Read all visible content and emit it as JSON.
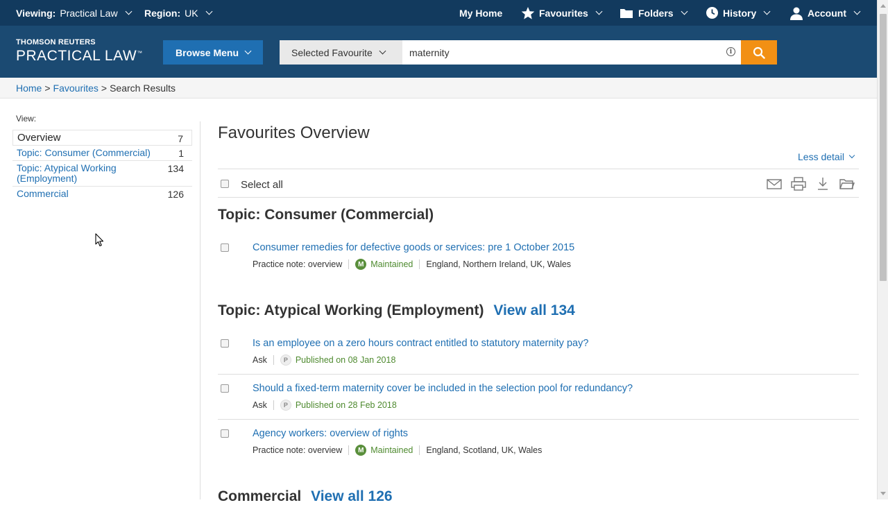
{
  "topbar": {
    "viewing_label": "Viewing:",
    "viewing_value": "Practical Law",
    "region_label": "Region:",
    "region_value": "UK",
    "my_home": "My Home",
    "favourites": "Favourites",
    "folders": "Folders",
    "history": "History",
    "account": "Account"
  },
  "brand": {
    "top": "THOMSON REUTERS",
    "main": "PRACTICAL LAW",
    "tm": "™"
  },
  "header": {
    "browse_menu": "Browse Menu",
    "scope_selected": "Selected Favourite",
    "search_value": "maternity"
  },
  "breadcrumb": {
    "home": "Home",
    "favourites": "Favourites",
    "current": "Search Results",
    "separator": ">"
  },
  "sidebar": {
    "view_label": "View:",
    "facets": [
      {
        "label": "Overview",
        "count": "7"
      },
      {
        "label": "Topic: Consumer (Commercial)",
        "count": "1"
      },
      {
        "label": "Topic: Atypical Working (Employment)",
        "count": "134"
      },
      {
        "label": "Commercial",
        "count": "126"
      }
    ]
  },
  "main": {
    "title": "Favourites Overview",
    "less_detail": "Less detail",
    "select_all": "Select all",
    "sections": [
      {
        "heading": "Topic: Consumer (Commercial)",
        "view_all": "",
        "results": [
          {
            "title": "Consumer remedies for defective goods or services: pre 1 October 2015",
            "type": "Practice note: overview",
            "badge": "M",
            "status": "Maintained",
            "jurisdictions": "England, Northern Ireland, UK, Wales"
          }
        ]
      },
      {
        "heading": "Topic: Atypical Working (Employment)",
        "view_all": "View all 134",
        "results": [
          {
            "title": "Is an employee on a zero hours contract entitled to statutory maternity pay?",
            "type": "Ask",
            "badge": "P",
            "status": "Published on 08 Jan 2018",
            "jurisdictions": ""
          },
          {
            "title": "Should a fixed-term maternity cover be included in the selection pool for redundancy?",
            "type": "Ask",
            "badge": "P",
            "status": "Published on 28 Feb 2018",
            "jurisdictions": ""
          },
          {
            "title": "Agency workers: overview of rights",
            "type": "Practice note: overview",
            "badge": "M",
            "status": "Maintained",
            "jurisdictions": "England, Scotland, UK, Wales"
          }
        ]
      },
      {
        "heading": "Commercial",
        "view_all": "View all 126",
        "results": []
      }
    ]
  },
  "colors": {
    "topbar": "#123a5e",
    "header": "#1b4a72",
    "browse_button": "#1f6fb2",
    "search_button": "#f29014",
    "link": "#1f6fb2",
    "maintained_badge": "#5a8f3c"
  },
  "icons": {
    "favourites": "star-icon",
    "folders": "folder-icon",
    "history": "clock-icon",
    "account": "user-icon",
    "search": "search-icon",
    "info": "info-icon",
    "email": "email-icon",
    "print": "print-icon",
    "download": "download-icon",
    "save_folder": "folder-open-icon"
  }
}
